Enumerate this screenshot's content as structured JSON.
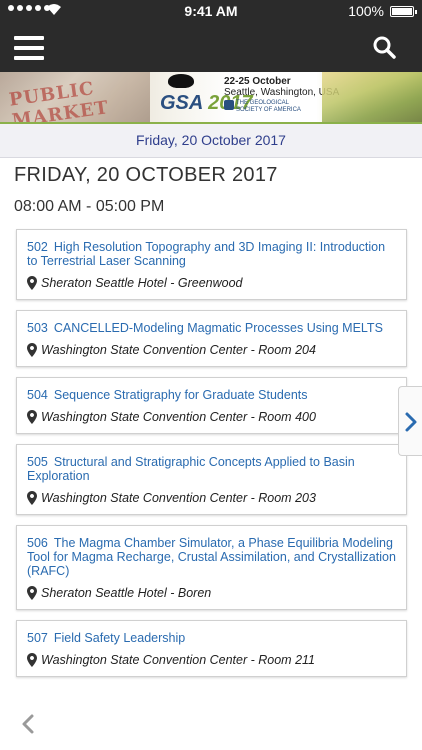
{
  "status_bar": {
    "time": "9:41 AM",
    "battery": "100%"
  },
  "header": {
    "menu_icon": "hamburger-menu-icon",
    "search_icon": "search-icon"
  },
  "banner": {
    "logo_text": "GSA",
    "logo_year": "2017",
    "event_dates": "22-25 October",
    "event_location": "Seattle, Washington, USA",
    "society_name": "THE GEOLOGICAL SOCIETY OF AMERICA"
  },
  "date_bar": {
    "label": "Friday, 20 October 2017"
  },
  "day": {
    "title": "FRIDAY, 20 OCTOBER 2017",
    "time_range": "08:00 AM - 05:00 PM"
  },
  "sessions": [
    {
      "code": "502",
      "title": "High Resolution Topography and 3D Imaging II: Introduction to Terrestrial Laser Scanning",
      "location": "Sheraton Seattle Hotel - Greenwood"
    },
    {
      "code": "503",
      "title": "CANCELLED-Modeling Magmatic Processes Using MELTS",
      "location": "Washington State Convention Center - Room 204"
    },
    {
      "code": "504",
      "title": "Sequence Stratigraphy for Graduate Students",
      "location": "Washington State Convention Center - Room 400"
    },
    {
      "code": "505",
      "title": "Structural and Stratigraphic Concepts Applied to Basin Exploration",
      "location": "Washington State Convention Center - Room 203"
    },
    {
      "code": "506",
      "title": "The Magma Chamber Simulator, a Phase Equilibria Modeling Tool for Magma Recharge, Crustal Assimilation, and Crystallization (RAFC)",
      "location": "Sheraton Seattle Hotel - Boren"
    },
    {
      "code": "507",
      "title": "Field Safety Leadership",
      "location": "Washington State Convention Center - Room 211"
    }
  ],
  "colors": {
    "link": "#2a6bb0",
    "header_bg": "#2b2b2b",
    "date_bar_text": "#2f3e8c",
    "accent_green": "#8bb14a"
  }
}
